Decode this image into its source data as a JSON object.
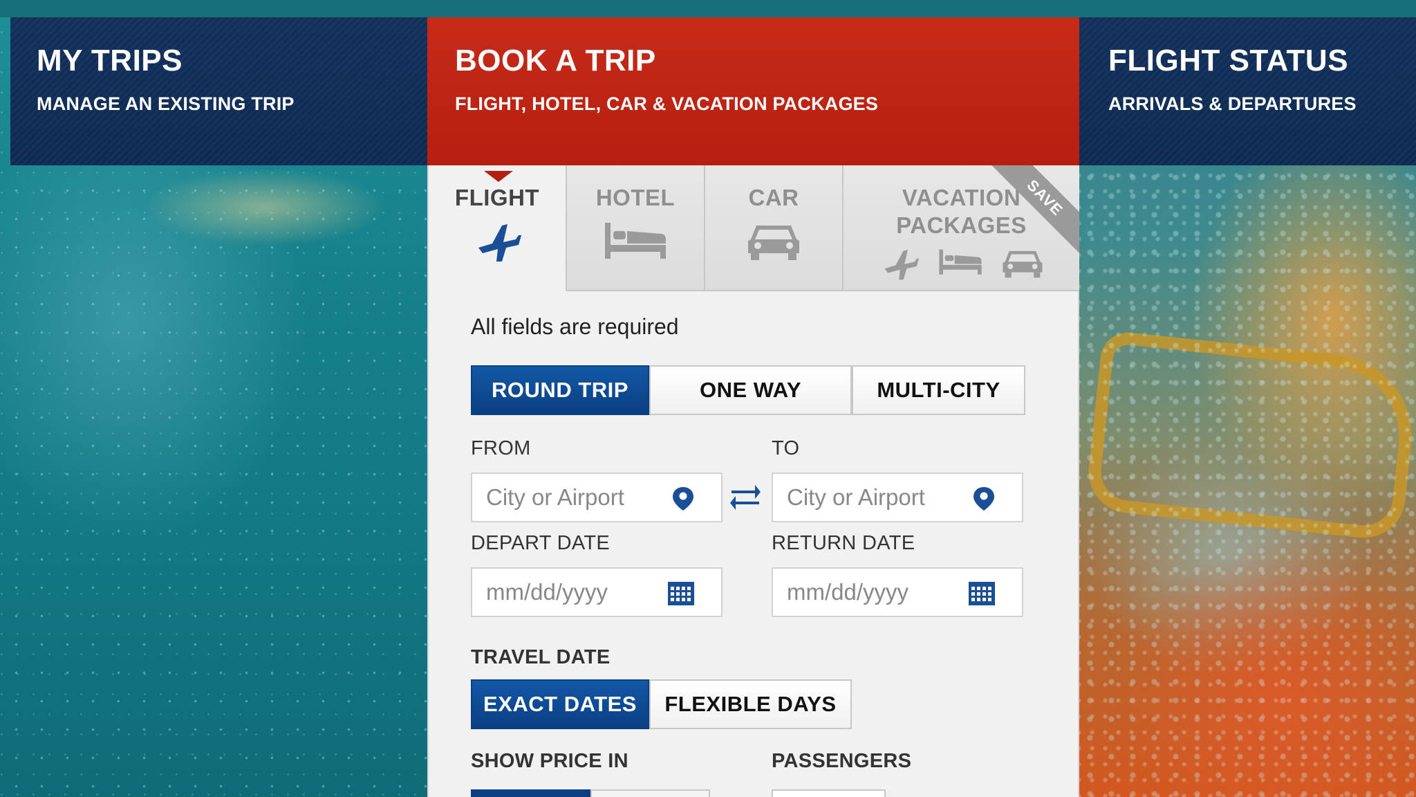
{
  "nav": {
    "my_trips": {
      "title": "MY TRIPS",
      "subtitle": "MANAGE AN EXISTING TRIP"
    },
    "book_trip": {
      "title": "BOOK A TRIP",
      "subtitle": "FLIGHT, HOTEL, CAR & VACATION PACKAGES"
    },
    "flight_status": {
      "title": "FLIGHT STATUS",
      "subtitle": "ARRIVALS & DEPARTURES"
    }
  },
  "product_tabs": [
    {
      "label": "FLIGHT",
      "icon": "airplane-icon",
      "selected": true
    },
    {
      "label": "HOTEL",
      "icon": "bed-icon",
      "selected": false
    },
    {
      "label": "CAR",
      "icon": "car-icon",
      "selected": false
    },
    {
      "label_line1": "VACATION",
      "label_line2": "PACKAGES",
      "icons": [
        "airplane-icon",
        "bed-icon",
        "car-icon"
      ],
      "badge": "SAVE",
      "selected": false
    }
  ],
  "form": {
    "required_note": "All fields are required",
    "trip_types": [
      "ROUND TRIP",
      "ONE WAY",
      "MULTI-CITY"
    ],
    "trip_type_selected": "ROUND TRIP",
    "from_label": "FROM",
    "to_label": "TO",
    "from_placeholder": "City or Airport",
    "to_placeholder": "City or Airport",
    "depart_label": "DEPART DATE",
    "return_label": "RETURN DATE",
    "depart_placeholder": "mm/dd/yyyy",
    "return_placeholder": "mm/dd/yyyy",
    "travel_date_label": "TRAVEL DATE",
    "travel_date_options": [
      "EXACT DATES",
      "FLEXIBLE DAYS"
    ],
    "travel_date_selected": "EXACT DATES",
    "show_price_label": "SHOW PRICE IN",
    "passengers_label": "PASSENGERS"
  },
  "colors": {
    "nav_dark": "#0d2a52",
    "nav_active": "#b61f10",
    "selected_button": "#0b3f84",
    "icon_blue": "#1a4f98"
  }
}
